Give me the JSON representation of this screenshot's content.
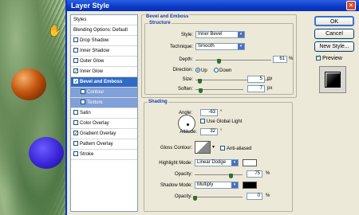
{
  "window": {
    "title": "Layer Style",
    "close_label": "×"
  },
  "styles_list": [
    {
      "label": "Styles",
      "type": "hdr",
      "checked": null
    },
    {
      "label": "Blending Options: Default",
      "type": "hdr",
      "checked": null
    },
    {
      "label": "Drop Shadow",
      "type": "item",
      "checked": false
    },
    {
      "label": "Inner Shadow",
      "type": "item",
      "checked": false
    },
    {
      "label": "Outer Glow",
      "type": "item",
      "checked": false
    },
    {
      "label": "Inner Glow",
      "type": "item",
      "checked": true
    },
    {
      "label": "Bevel and Emboss",
      "type": "sel",
      "checked": true
    },
    {
      "label": "Contour",
      "type": "sub",
      "checked": false
    },
    {
      "label": "Texture",
      "type": "sub",
      "checked": false
    },
    {
      "label": "Satin",
      "type": "item",
      "checked": false
    },
    {
      "label": "Color Overlay",
      "type": "item",
      "checked": false
    },
    {
      "label": "Gradient Overlay",
      "type": "item",
      "checked": true
    },
    {
      "label": "Pattern Overlay",
      "type": "item",
      "checked": false
    },
    {
      "label": "Stroke",
      "type": "item",
      "checked": false
    }
  ],
  "bevel": {
    "title": "Bevel and Emboss",
    "structure": "Structure",
    "style_label": "Style:",
    "style_value": "Inner Bevel",
    "technique_label": "Technique:",
    "technique_value": "Smooth",
    "depth_label": "Depth:",
    "depth_value": "61",
    "depth_unit": "%",
    "depth_frac": 0.3,
    "direction_label": "Direction:",
    "dir_up": "Up",
    "dir_down": "Down",
    "size_label": "Size:",
    "size_value": "5",
    "size_unit": "px",
    "size_frac": 0.05,
    "soften_label": "Soften:",
    "soften_value": "7",
    "soften_unit": "px",
    "soften_frac": 0.1
  },
  "shading": {
    "title": "Shading",
    "angle_label": "Angle:",
    "angle_value": "-63",
    "angle_unit": "°",
    "global_light": "Use Global Light",
    "altitude_label": "Altitude:",
    "altitude_value": "32",
    "altitude_unit": "°",
    "gloss_label": "Gloss Contour:",
    "anti_aliased": "Anti-aliased",
    "highlight_label": "Highlight Mode:",
    "highlight_value": "Linear Dodge",
    "highlight_color": "#ffffff",
    "h_opacity_label": "Opacity:",
    "h_opacity_value": "75",
    "h_opacity_unit": "%",
    "h_opacity_frac": 0.75,
    "shadow_label": "Shadow Mode:",
    "shadow_value": "Multiply",
    "shadow_color": "#000000",
    "s_opacity_label": "Opacity:",
    "s_opacity_value": "0",
    "s_opacity_unit": "%",
    "s_opacity_frac": 0.0
  },
  "buttons": {
    "ok": "OK",
    "cancel": "Cancel",
    "new_style": "New Style...",
    "preview": "Preview"
  },
  "colors": {
    "accent": "#316ac5",
    "titlebar": "#0a3ac8"
  }
}
